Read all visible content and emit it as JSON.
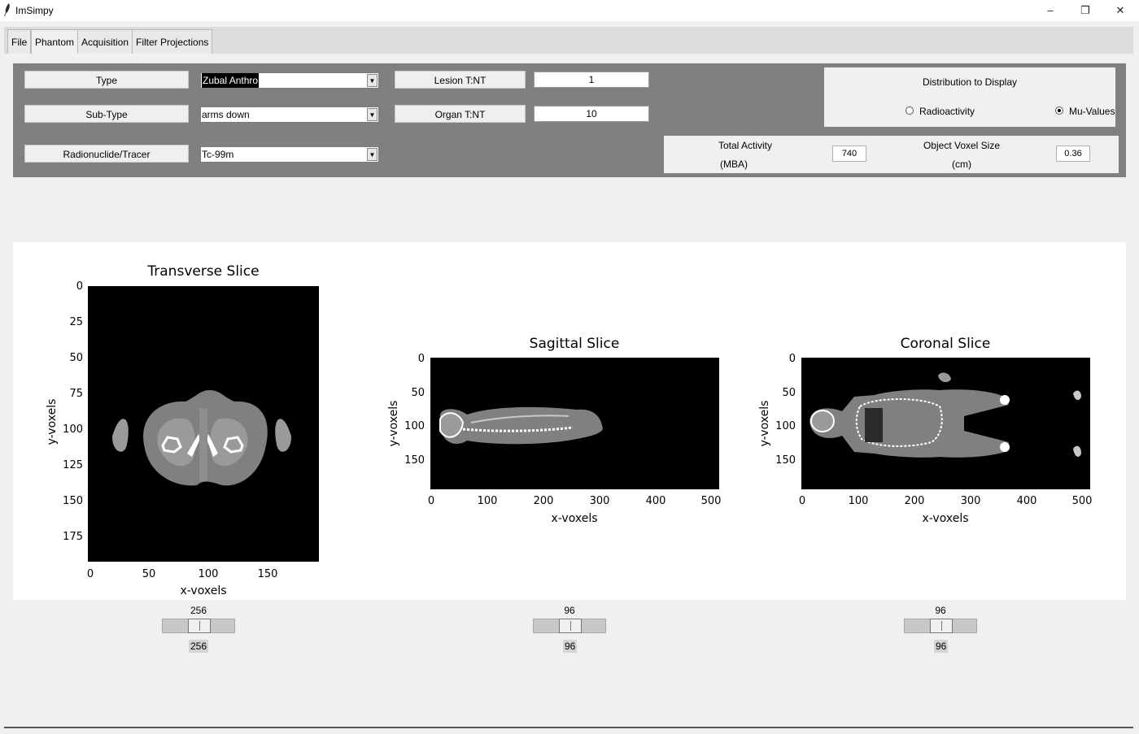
{
  "window": {
    "title": "ImSimpy",
    "controls": {
      "minimize": "–",
      "restore": "❐",
      "close": "✕"
    }
  },
  "tabs": [
    {
      "label": "File"
    },
    {
      "label": "Phantom"
    },
    {
      "label": "Acquisition"
    },
    {
      "label": "Filter Projections"
    }
  ],
  "form": {
    "type_label": "Type",
    "type_value": "Zubal Anthro",
    "subtype_label": "Sub-Type",
    "subtype_value": "arms down",
    "tracer_label": "Radionuclide/Tracer",
    "tracer_value": "Tc-99m",
    "lesion_label": "Lesion T:NT",
    "lesion_value": "1",
    "organ_label": "Organ T:NT",
    "organ_value": "10",
    "distribution": {
      "title": "Distribution to Display",
      "option_radioactivity": "Radioactivity",
      "option_mu": "Mu-Values",
      "selected": "Mu-Values"
    },
    "total_activity_label_1": "Total Activity",
    "total_activity_label_2": "(MBA)",
    "total_activity_value": "740",
    "voxel_size_label_1": "Object Voxel Size",
    "voxel_size_label_2": "(cm)",
    "voxel_size_value": "0.36"
  },
  "chart_data": [
    {
      "type": "heatmap",
      "title": "Transverse Slice",
      "xlabel": "x-voxels",
      "ylabel": "y-voxels",
      "xlim": [
        0,
        192
      ],
      "ylim": [
        192,
        0
      ],
      "xticks": [
        "0",
        "50",
        "100",
        "150"
      ],
      "yticks": [
        "0",
        "25",
        "50",
        "75",
        "100",
        "125",
        "150",
        "175"
      ],
      "colormap": "gray"
    },
    {
      "type": "heatmap",
      "title": "Sagittal Slice",
      "xlabel": "x-voxels",
      "ylabel": "y-voxels",
      "xlim": [
        0,
        512
      ],
      "ylim": [
        192,
        0
      ],
      "xticks": [
        "0",
        "100",
        "200",
        "300",
        "400",
        "500"
      ],
      "yticks": [
        "0",
        "50",
        "100",
        "150"
      ],
      "colormap": "gray"
    },
    {
      "type": "heatmap",
      "title": "Coronal Slice",
      "xlabel": "x-voxels",
      "ylabel": "y-voxels",
      "xlim": [
        0,
        512
      ],
      "ylim": [
        192,
        0
      ],
      "xticks": [
        "0",
        "100",
        "200",
        "300",
        "400",
        "500"
      ],
      "yticks": [
        "0",
        "50",
        "100",
        "150"
      ],
      "colormap": "gray"
    }
  ],
  "sliders": [
    {
      "name": "transverse",
      "top_value": "256",
      "bottom_value": "256"
    },
    {
      "name": "sagittal",
      "top_value": "96",
      "bottom_value": "96"
    },
    {
      "name": "coronal",
      "top_value": "96",
      "bottom_value": "96"
    }
  ]
}
